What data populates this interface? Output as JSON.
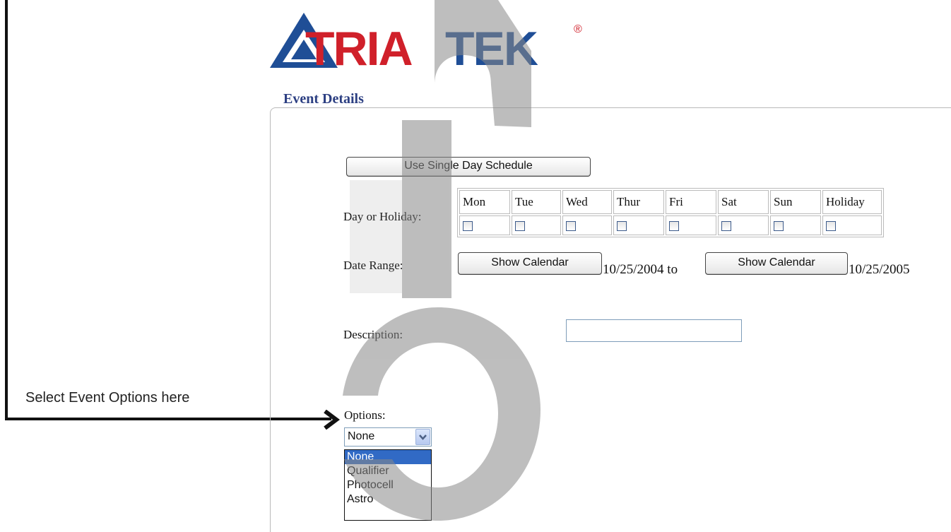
{
  "callout": {
    "text": "Select Event Options here"
  },
  "logo": {
    "text": "TRIATEK",
    "registered": "®"
  },
  "section": {
    "legend": "Event Details"
  },
  "single_day_button": "Use Single Day Schedule",
  "days": {
    "label": "Day or Holiday:",
    "items": [
      "Mon",
      "Tue",
      "Wed",
      "Thur",
      "Fri",
      "Sat",
      "Sun",
      "Holiday"
    ]
  },
  "date_range": {
    "label": "Date Range:",
    "show_calendar": "Show Calendar",
    "start": "10/25/2004 to",
    "end": "10/25/2005"
  },
  "description": {
    "label": "Description:",
    "value": ""
  },
  "options": {
    "label": "Options:",
    "selected": "None",
    "list": [
      "None",
      "Qualifier",
      "Photocell",
      "Astro"
    ]
  },
  "colors": {
    "legend": "#2c3f82",
    "logo_red": "#d0202a",
    "logo_blue": "#1f4e96",
    "highlight": "#316ac5"
  }
}
